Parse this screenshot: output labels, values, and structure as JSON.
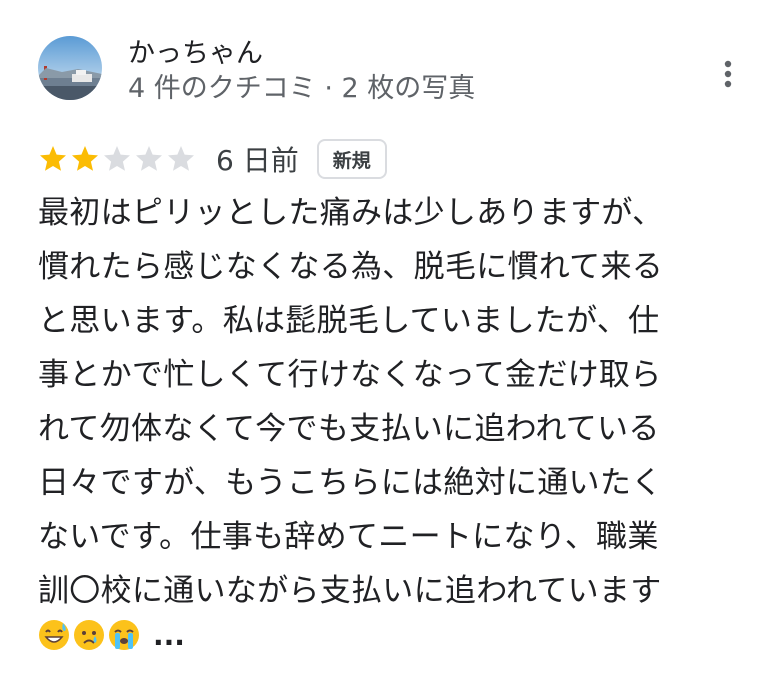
{
  "user": {
    "name": "かっちゃん",
    "meta": "4 件のクチコミ · 2 枚の写真"
  },
  "rating": {
    "value": 2,
    "max": 5,
    "filled_color": "#fbbc04",
    "empty_color": "#dadce0"
  },
  "review": {
    "date": "6 日前",
    "badge": "新規",
    "lines": [
      "最初はピリッとした痛みは少しありますが、",
      "慣れたら感じなくなる為、脱毛に慣れて来る",
      "と思います。私は髭脱毛していましたが、仕",
      "事とかで忙しくて行けなくなって金だけ取ら",
      "れて勿体なくて今でも支払いに追われている",
      "日々ですが、もうこちらには絶対に通いたく",
      "ないです。仕事も辞めてニートになり、職業",
      "訓〇校に通いながら支払いに追われています"
    ],
    "emojis": [
      "grinning-sweat-emoji",
      "crying-emoji",
      "loudly-crying-emoji"
    ],
    "more_label": "..."
  },
  "icons": {
    "menu": "more-vert-icon",
    "star": "star-icon"
  }
}
